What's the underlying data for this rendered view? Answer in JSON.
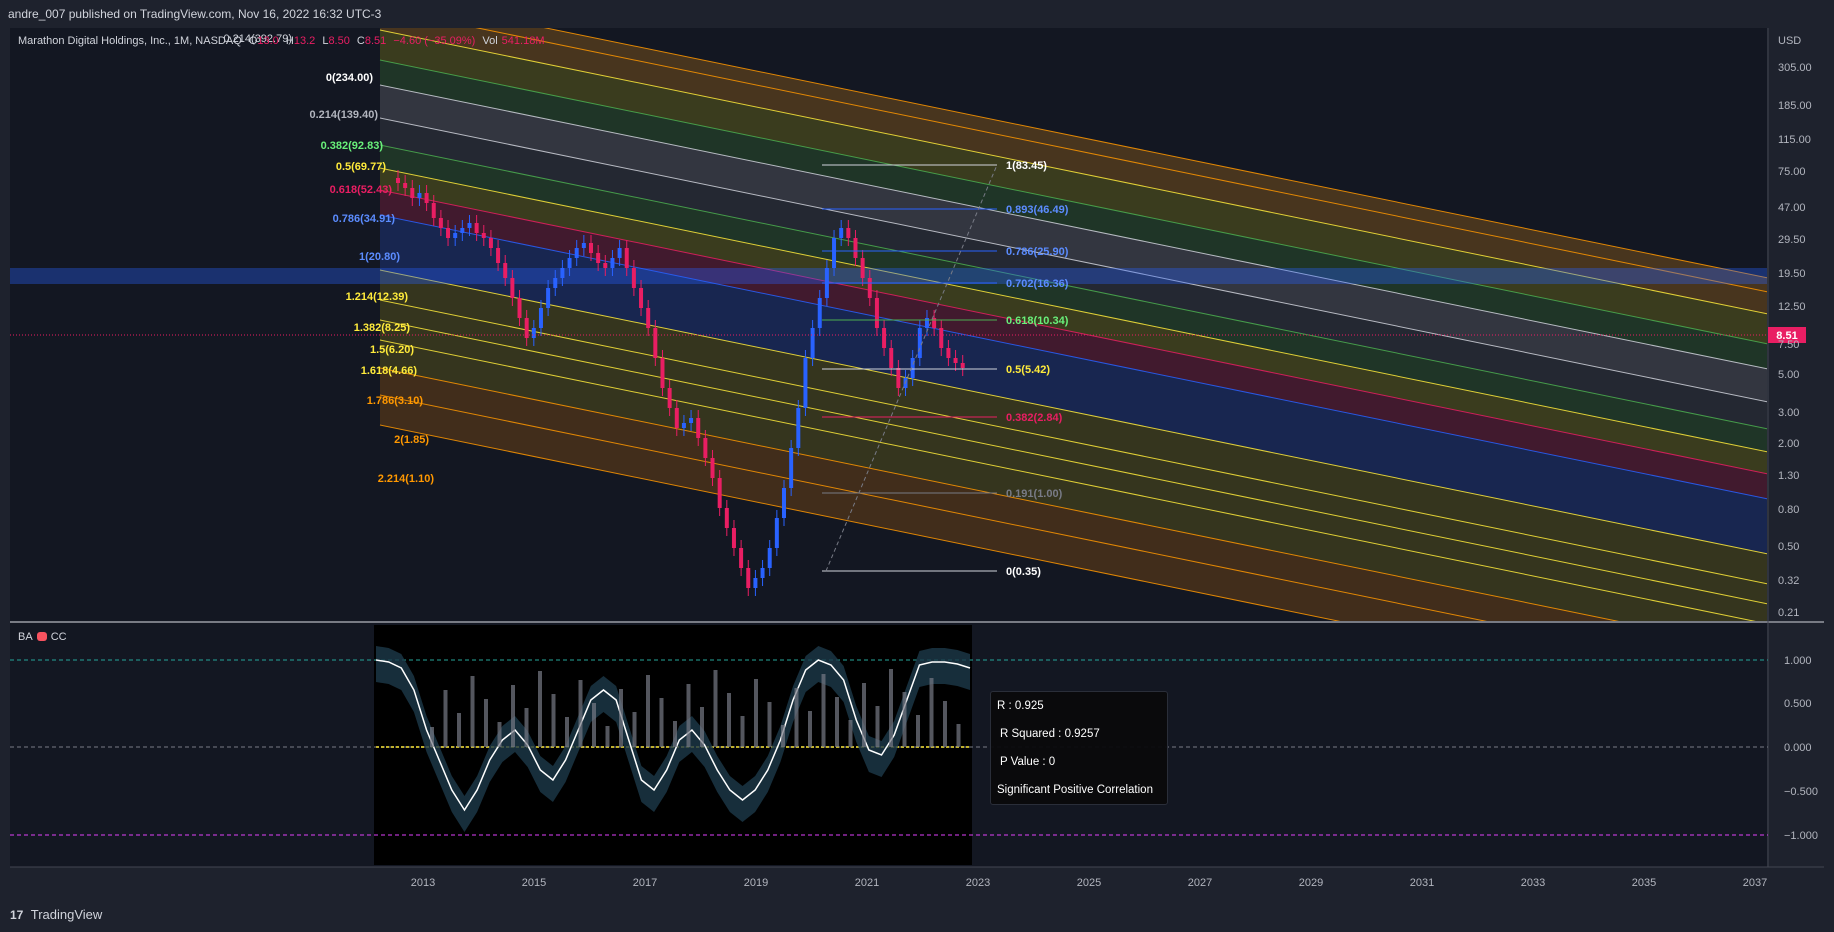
{
  "header": {
    "publisher": "andre_007 published on TradingView.com, Nov 16, 2022 16:32 UTC-3"
  },
  "footer": {
    "brand": "TradingView",
    "logo_glyph": "17"
  },
  "legend": {
    "symbol": "Marathon Digital Holdings, Inc., 1M, NASDAQ",
    "o_label": "O",
    "o_value": "13.0",
    "h_label": "H",
    "h_value": "13.2",
    "l_label": "L",
    "l_value": "8.50",
    "c_label": "C",
    "c_value": "8.51",
    "change": "−4.60 (−35.09%)",
    "vol_label": "Vol",
    "vol_value": "541.18M"
  },
  "indicator_legend": {
    "name": "BA",
    "suffix": "CC"
  },
  "colors": {
    "up": "#2962ff",
    "down": "#e91e63",
    "bg": "#131722",
    "panel": "#1e222d"
  },
  "chart_data": {
    "type": "candlestick",
    "currency": "USD",
    "last_price": "8.51",
    "x_ticks": [
      "2013",
      "2015",
      "2017",
      "2019",
      "2021",
      "2023",
      "2025",
      "2027",
      "2029",
      "2031",
      "2033",
      "2035",
      "2037"
    ],
    "y_ticks": [
      "305.00",
      "185.00",
      "115.00",
      "75.00",
      "47.00",
      "29.50",
      "19.50",
      "12.50",
      "7.50",
      "5.00",
      "3.00",
      "2.00",
      "1.30",
      "0.80",
      "0.50",
      "0.32",
      "0.21"
    ],
    "y_scale": "log",
    "fib_channel_labels": [
      {
        "level": "0.214(392.79)"
      },
      {
        "level": "0(234.00)"
      },
      {
        "level": "0.214(139.40)"
      },
      {
        "level": "0.382(92.83)"
      },
      {
        "level": "0.5(69.77)"
      },
      {
        "level": "0.618(52.43)"
      },
      {
        "level": "0.786(34.91)"
      },
      {
        "level": "1(20.80)"
      },
      {
        "level": "1.214(12.39)"
      },
      {
        "level": "1.382(8.25)"
      },
      {
        "level": "1.5(6.20)"
      },
      {
        "level": "1.618(4.66)"
      },
      {
        "level": "1.786(3.10)"
      },
      {
        "level": "2(1.85)"
      },
      {
        "level": "2.214(1.10)"
      }
    ],
    "fib_retracement_labels": [
      {
        "level": "1(83.45)"
      },
      {
        "level": "0.893(46.49)"
      },
      {
        "level": "0.786(25.90)"
      },
      {
        "level": "0.702(16.36)"
      },
      {
        "level": "0.618(10.34)"
      },
      {
        "level": "0.5(5.42)"
      },
      {
        "level": "0.382(2.84)"
      },
      {
        "level": "0.191(1.00)"
      },
      {
        "level": "0(0.35)"
      }
    ],
    "indicator": {
      "y_ticks": [
        "1.000",
        "0.500",
        "0.000",
        "−0.500",
        "−1.000"
      ],
      "stats": {
        "r": "R : 0.925",
        "r2": "R Squared : 0.9257",
        "p": "P Value : 0",
        "verdict": "Significant Positive Correlation"
      }
    }
  }
}
